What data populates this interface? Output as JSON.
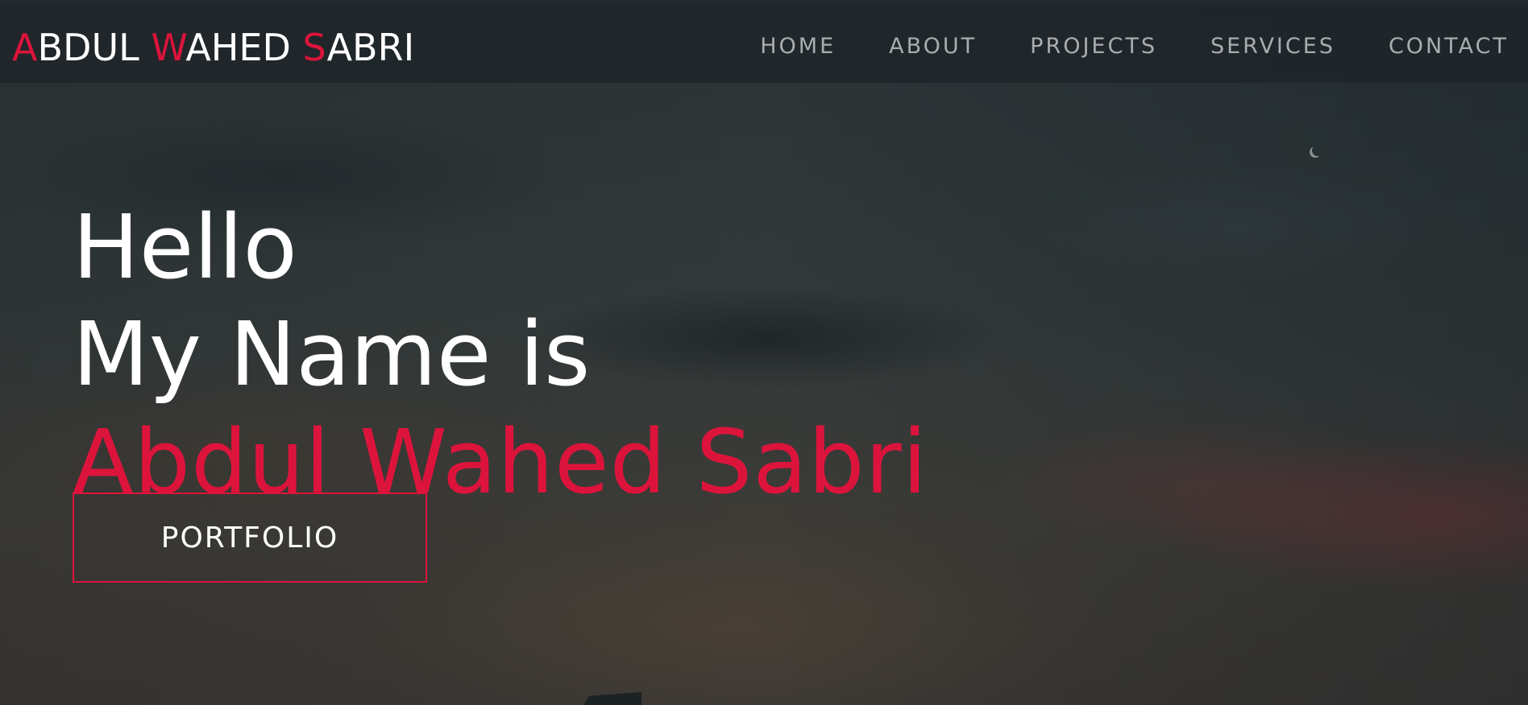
{
  "brand": {
    "parts": [
      {
        "text": "A",
        "accent": true
      },
      {
        "text": "BDUL ",
        "accent": false
      },
      {
        "text": "W",
        "accent": true
      },
      {
        "text": "AHED ",
        "accent": false
      },
      {
        "text": "S",
        "accent": true
      },
      {
        "text": "ABRI",
        "accent": false
      }
    ]
  },
  "nav": {
    "items": [
      "HOME",
      "ABOUT",
      "PROJECTS",
      "SERVICES",
      "CONTACT"
    ]
  },
  "hero": {
    "line1": "Hello",
    "line2": "My Name is",
    "name": "Abdul Wahed Sabri",
    "button_label": "PORTFOLIO"
  },
  "colors": {
    "accent": "#dc143c",
    "nav_text": "#a9adb0",
    "heading_text": "#ffffff"
  }
}
